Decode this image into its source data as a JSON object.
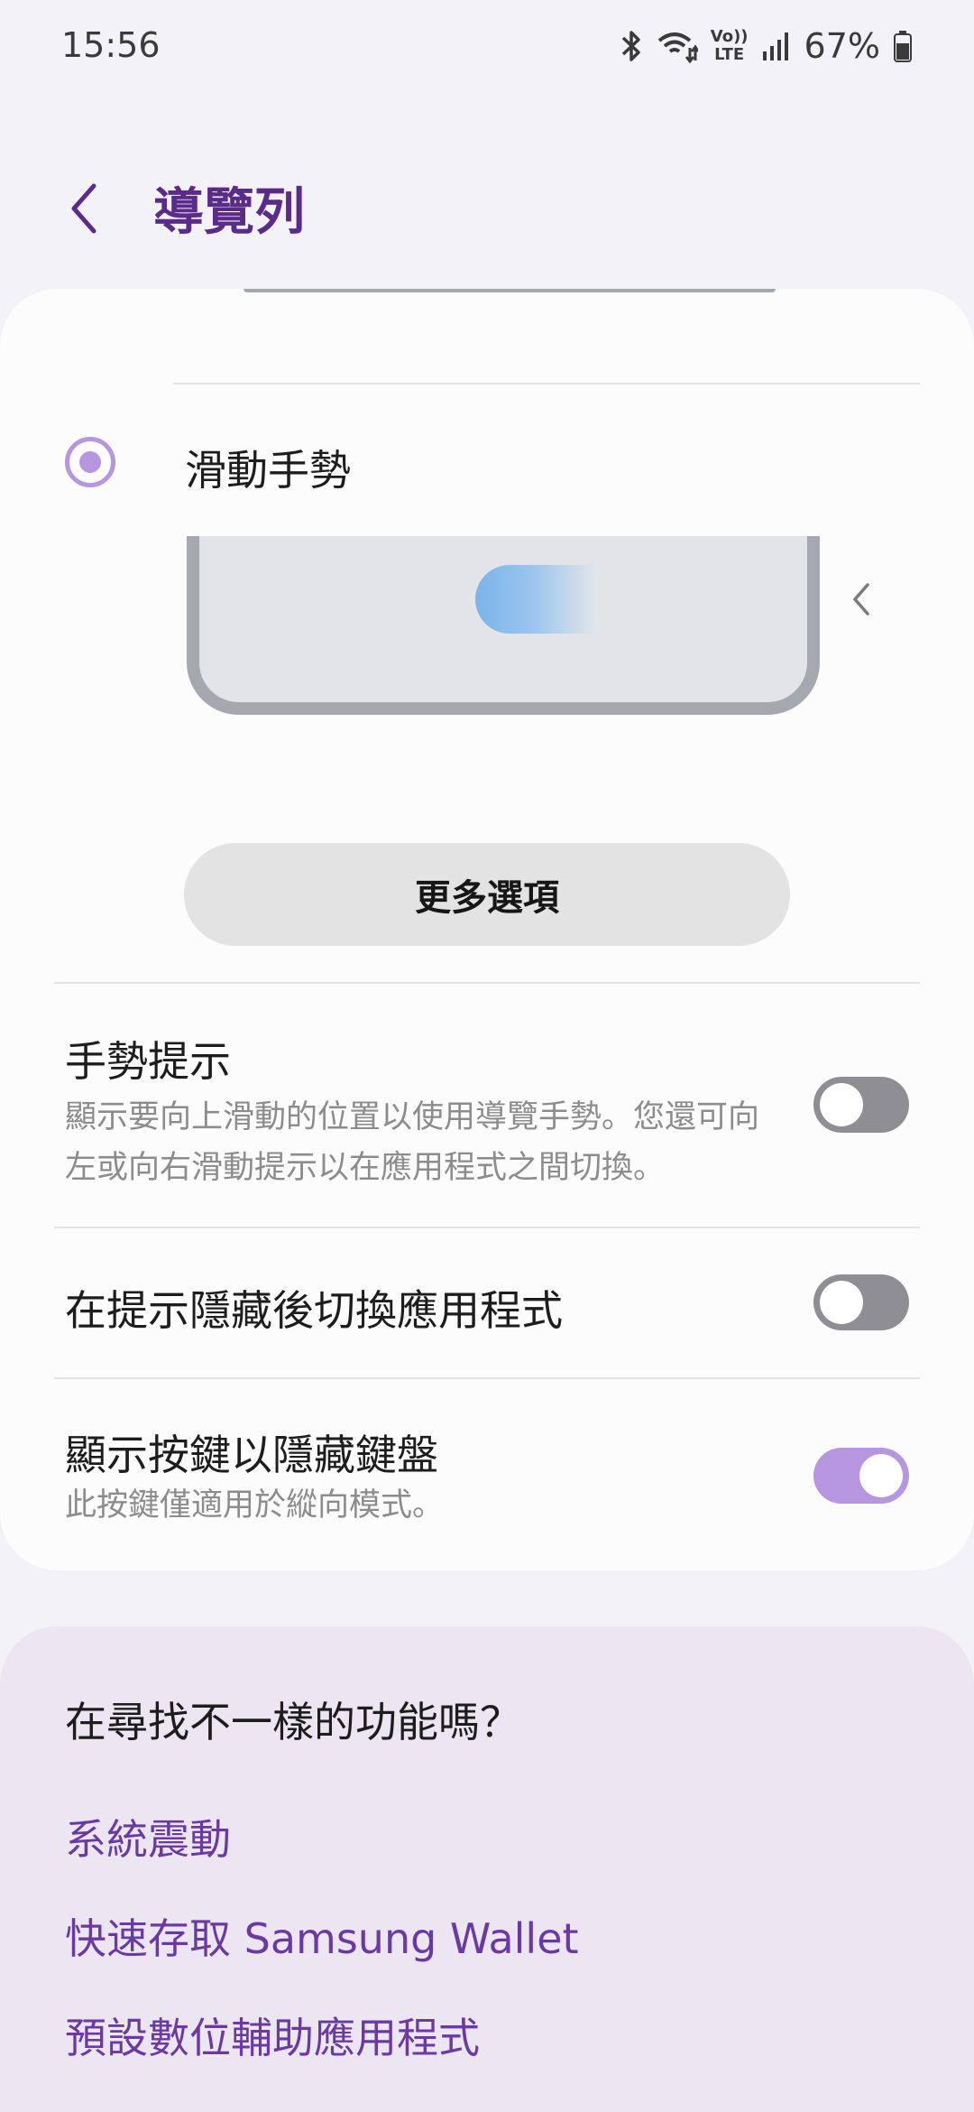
{
  "status_bar": {
    "time": "15:56",
    "battery_percent": "67%",
    "icons": [
      "bluetooth-icon",
      "wifi-icon",
      "volte-icon",
      "signal-icon",
      "battery-icon"
    ],
    "volte_top": "Vo))",
    "volte_bottom": "LTE"
  },
  "header": {
    "title": "導覽列",
    "back_icon": "chevron-left-icon"
  },
  "gesture_option": {
    "label": "滑動手勢",
    "selected": true
  },
  "more_options_button": "更多選項",
  "settings": [
    {
      "title": "手勢提示",
      "description": "顯示要向上滑動的位置以使用導覽手勢。您還可向左或向右滑動提示以在應用程式之間切換。",
      "enabled": false
    },
    {
      "title": "在提示隱藏後切換應用程式",
      "enabled": false
    },
    {
      "title": "顯示按鍵以隱藏鍵盤",
      "description": "此按鍵僅適用於縱向模式。",
      "enabled": true
    }
  ],
  "suggestions": {
    "heading": "在尋找不一樣的功能嗎？",
    "links": [
      "系統震動",
      "快速存取 Samsung Wallet",
      "預設數位輔助應用程式"
    ]
  },
  "colors": {
    "accent": "#b596df",
    "title": "#5b2b8a",
    "link": "#6a3aa2",
    "toggle_off": "#8e8e93"
  }
}
